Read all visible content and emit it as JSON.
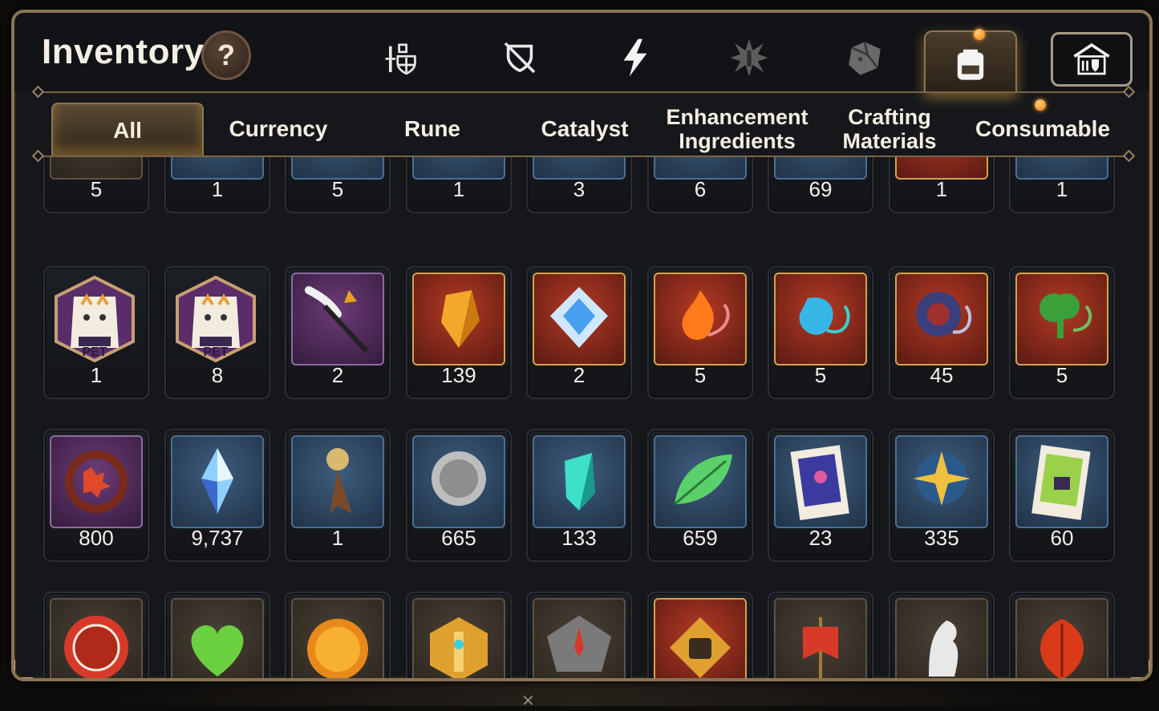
{
  "header": {
    "title": "Inventory",
    "help_label": "?"
  },
  "top_tabs": [
    {
      "name": "equipment-icon"
    },
    {
      "name": "no-shield-icon"
    },
    {
      "name": "lightning-icon"
    },
    {
      "name": "burst-icon"
    },
    {
      "name": "cube-icon"
    },
    {
      "name": "backpack-icon",
      "active": true
    },
    {
      "name": "storage-house-icon"
    }
  ],
  "sub_tabs": [
    {
      "line1": "All",
      "line2": "",
      "active": true
    },
    {
      "line1": "Currency",
      "line2": ""
    },
    {
      "line1": "Rune",
      "line2": ""
    },
    {
      "line1": "Catalyst",
      "line2": ""
    },
    {
      "line1": "Enhancement",
      "line2": "Ingredients"
    },
    {
      "line1": "Crafting",
      "line2": "Materials"
    },
    {
      "line1": "Consumable",
      "line2": ""
    }
  ],
  "rows": [
    [
      {
        "icon": "map-scroll-icon",
        "qty": "5"
      },
      {
        "icon": "purple-gem-icon",
        "qty": "1"
      },
      {
        "icon": "orange-medallion-icon",
        "qty": "5"
      },
      {
        "icon": "rune-stones-icon",
        "qty": "1"
      },
      {
        "icon": "fire-orb-icon",
        "qty": "3"
      },
      {
        "icon": "dark-eye-orb-icon",
        "qty": "6"
      },
      {
        "icon": "leaf-bundle-icon",
        "qty": "69"
      },
      {
        "icon": "green-shield-icon",
        "qty": "1"
      },
      {
        "icon": "blue-circle-icon",
        "qty": "1"
      }
    ],
    [
      {
        "icon": "pet-food-bag-icon",
        "qty": "1",
        "label": "PET"
      },
      {
        "icon": "pet-food-bag-icon",
        "qty": "8",
        "label": "PET"
      },
      {
        "icon": "feather-wand-icon",
        "qty": "2"
      },
      {
        "icon": "amber-crystal-icon",
        "qty": "139"
      },
      {
        "icon": "blue-diamond-icon",
        "qty": "2"
      },
      {
        "icon": "fire-pendant-icon",
        "qty": "5"
      },
      {
        "icon": "water-pendant-icon",
        "qty": "5"
      },
      {
        "icon": "dark-ring-pendant-icon",
        "qty": "45"
      },
      {
        "icon": "tree-pendant-icon",
        "qty": "5"
      }
    ],
    [
      {
        "icon": "red-flower-ring-icon",
        "qty": "800"
      },
      {
        "icon": "blue-crystal-icon",
        "qty": "9,737"
      },
      {
        "icon": "pocket-watch-key-icon",
        "qty": "1"
      },
      {
        "icon": "silver-coin-icon",
        "qty": "665"
      },
      {
        "icon": "teal-crystal-icon",
        "qty": "133"
      },
      {
        "icon": "green-leaf-icon",
        "qty": "659"
      },
      {
        "icon": "blue-ticket-icon",
        "qty": "23"
      },
      {
        "icon": "star-compass-icon",
        "qty": "335"
      },
      {
        "icon": "green-ticket-icon",
        "qty": "60"
      }
    ],
    [
      {
        "icon": "red-badge-icon",
        "qty": ""
      },
      {
        "icon": "green-heart-icon",
        "qty": ""
      },
      {
        "icon": "gold-sun-coin-icon",
        "qty": ""
      },
      {
        "icon": "gold-hexagon-icon",
        "qty": ""
      },
      {
        "icon": "stone-compass-icon",
        "qty": ""
      },
      {
        "icon": "fist-emblem-icon",
        "qty": ""
      },
      {
        "icon": "red-banner-icon",
        "qty": ""
      },
      {
        "icon": "white-horse-icon",
        "qty": ""
      },
      {
        "icon": "red-leaf-icon",
        "qty": ""
      }
    ]
  ],
  "colors": {
    "frame": "#8b7453",
    "accent_glow": "#ffbe50",
    "notification": "#f07a10"
  }
}
